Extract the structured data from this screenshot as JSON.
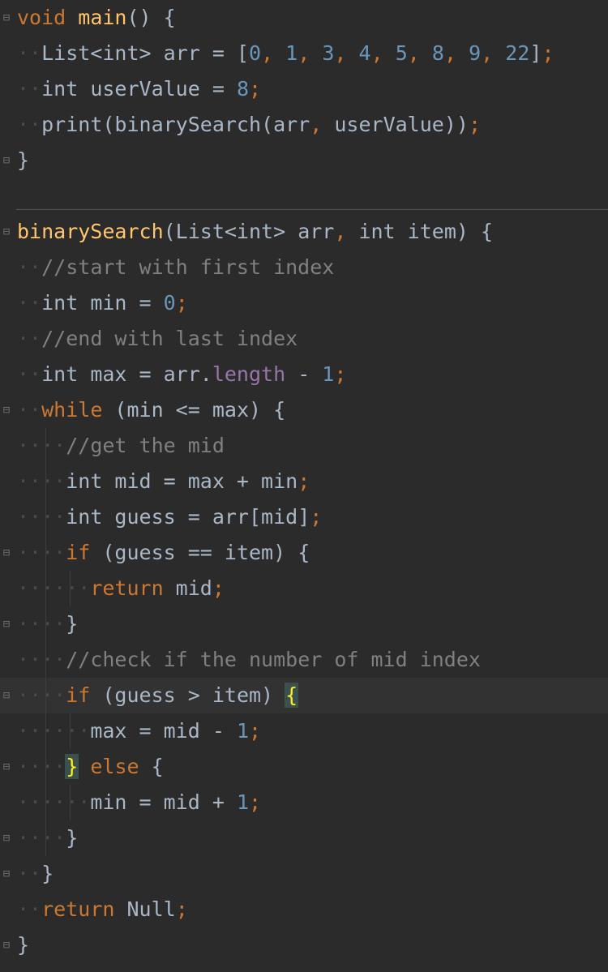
{
  "editor": {
    "lines": [
      {
        "indent": "",
        "tokens": [
          [
            "kw",
            "void"
          ],
          [
            "plain",
            " "
          ],
          [
            "fn",
            "main"
          ],
          [
            "plain",
            "() {"
          ]
        ]
      },
      {
        "indent": "··",
        "tokens": [
          [
            "plain",
            "List<int> arr = ["
          ],
          [
            "num",
            "0"
          ],
          [
            "punc",
            ","
          ],
          [
            "plain",
            " "
          ],
          [
            "num",
            "1"
          ],
          [
            "punc",
            ","
          ],
          [
            "plain",
            " "
          ],
          [
            "num",
            "3"
          ],
          [
            "punc",
            ","
          ],
          [
            "plain",
            " "
          ],
          [
            "num",
            "4"
          ],
          [
            "punc",
            ","
          ],
          [
            "plain",
            " "
          ],
          [
            "num",
            "5"
          ],
          [
            "punc",
            ","
          ],
          [
            "plain",
            " "
          ],
          [
            "num",
            "8"
          ],
          [
            "punc",
            ","
          ],
          [
            "plain",
            " "
          ],
          [
            "num",
            "9"
          ],
          [
            "punc",
            ","
          ],
          [
            "plain",
            " "
          ],
          [
            "num",
            "22"
          ],
          [
            "plain",
            "]"
          ],
          [
            "punc",
            ";"
          ]
        ]
      },
      {
        "indent": "··",
        "tokens": [
          [
            "plain",
            "int userValue = "
          ],
          [
            "num",
            "8"
          ],
          [
            "punc",
            ";"
          ]
        ]
      },
      {
        "indent": "··",
        "tokens": [
          [
            "plain",
            "print(binarySearch(arr"
          ],
          [
            "punc",
            ","
          ],
          [
            "plain",
            " userValue))"
          ],
          [
            "punc",
            ";"
          ]
        ]
      },
      {
        "indent": "",
        "tokens": [
          [
            "plain",
            "}"
          ]
        ]
      },
      {
        "indent": "",
        "tokens": []
      },
      {
        "indent": "",
        "tokens": [
          [
            "fn",
            "binarySearch"
          ],
          [
            "plain",
            "(List<int> arr"
          ],
          [
            "punc",
            ","
          ],
          [
            "plain",
            " int item) {"
          ]
        ]
      },
      {
        "indent": "··",
        "tokens": [
          [
            "cmt",
            "//start with first index"
          ]
        ]
      },
      {
        "indent": "··",
        "tokens": [
          [
            "plain",
            "int min = "
          ],
          [
            "num",
            "0"
          ],
          [
            "punc",
            ";"
          ]
        ]
      },
      {
        "indent": "··",
        "tokens": [
          [
            "cmt",
            "//end with last index"
          ]
        ]
      },
      {
        "indent": "··",
        "tokens": [
          [
            "plain",
            "int max = arr."
          ],
          [
            "prop",
            "length"
          ],
          [
            "plain",
            " - "
          ],
          [
            "num",
            "1"
          ],
          [
            "punc",
            ";"
          ]
        ]
      },
      {
        "indent": "··",
        "tokens": [
          [
            "kw",
            "while"
          ],
          [
            "plain",
            " (min <= max) {"
          ]
        ]
      },
      {
        "indent": "····",
        "tokens": [
          [
            "cmt",
            "//get the mid"
          ]
        ]
      },
      {
        "indent": "····",
        "tokens": [
          [
            "plain",
            "int mid = max + min"
          ],
          [
            "punc",
            ";"
          ]
        ]
      },
      {
        "indent": "····",
        "tokens": [
          [
            "plain",
            "int guess = arr[mid]"
          ],
          [
            "punc",
            ";"
          ]
        ]
      },
      {
        "indent": "····",
        "tokens": [
          [
            "kw",
            "if"
          ],
          [
            "plain",
            " (guess == item) {"
          ]
        ]
      },
      {
        "indent": "······",
        "tokens": [
          [
            "kw",
            "return"
          ],
          [
            "plain",
            " mid"
          ],
          [
            "punc",
            ";"
          ]
        ]
      },
      {
        "indent": "····",
        "tokens": [
          [
            "plain",
            "}"
          ]
        ]
      },
      {
        "indent": "····",
        "tokens": [
          [
            "cmt",
            "//check if the number of mid index"
          ]
        ]
      },
      {
        "indent": "····",
        "tokens": [
          [
            "kw",
            "if"
          ],
          [
            "plain",
            " (guess > item) "
          ],
          [
            "hl",
            "{"
          ]
        ],
        "current": true
      },
      {
        "indent": "······",
        "tokens": [
          [
            "plain",
            "max = mid - "
          ],
          [
            "num",
            "1"
          ],
          [
            "punc",
            ";"
          ]
        ]
      },
      {
        "indent": "····",
        "tokens": [
          [
            "hl",
            "}"
          ],
          [
            "plain",
            " "
          ],
          [
            "kw",
            "else"
          ],
          [
            "plain",
            " {"
          ]
        ]
      },
      {
        "indent": "······",
        "tokens": [
          [
            "plain",
            "min = mid + "
          ],
          [
            "num",
            "1"
          ],
          [
            "punc",
            ";"
          ]
        ]
      },
      {
        "indent": "····",
        "tokens": [
          [
            "plain",
            "}"
          ]
        ]
      },
      {
        "indent": "··",
        "tokens": [
          [
            "plain",
            "}"
          ]
        ]
      },
      {
        "indent": "··",
        "tokens": [
          [
            "kw",
            "return"
          ],
          [
            "plain",
            " Null"
          ],
          [
            "punc",
            ";"
          ]
        ]
      },
      {
        "indent": "",
        "tokens": [
          [
            "plain",
            "}"
          ]
        ]
      }
    ],
    "fold_markers": {
      "0": "⊟",
      "4": "⊟",
      "6": "⊟",
      "11": "⊟",
      "15": "⊟",
      "17": "⊟",
      "19": "⊟",
      "21": "⊟",
      "23": "⊟",
      "24": "⊟",
      "26": "⊟"
    }
  }
}
